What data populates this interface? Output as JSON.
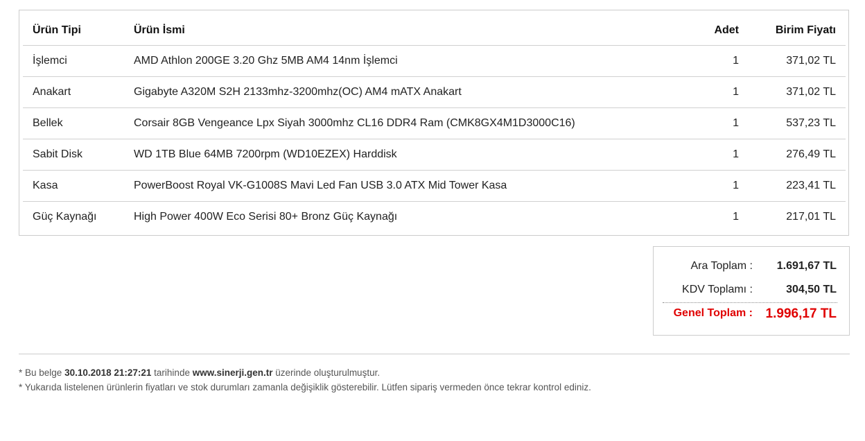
{
  "table": {
    "headers": {
      "type": "Ürün Tipi",
      "name": "Ürün İsmi",
      "qty": "Adet",
      "price": "Birim Fiyatı"
    },
    "rows": [
      {
        "type": "İşlemci",
        "name": "AMD Athlon 200GE 3.20 Ghz 5MB AM4 14nm İşlemci",
        "qty": "1",
        "price": "371,02 TL"
      },
      {
        "type": "Anakart",
        "name": "Gigabyte A320M S2H 2133mhz-3200mhz(OC) AM4 mATX Anakart",
        "qty": "1",
        "price": "371,02 TL"
      },
      {
        "type": "Bellek",
        "name": "Corsair 8GB Vengeance Lpx Siyah 3000mhz CL16 DDR4 Ram (CMK8GX4M1D3000C16)",
        "qty": "1",
        "price": "537,23 TL"
      },
      {
        "type": "Sabit Disk",
        "name": "WD 1TB Blue 64MB 7200rpm (WD10EZEX) Harddisk",
        "qty": "1",
        "price": "276,49 TL"
      },
      {
        "type": "Kasa",
        "name": "PowerBoost Royal VK-G1008S Mavi Led Fan USB 3.0 ATX Mid Tower Kasa",
        "qty": "1",
        "price": "223,41 TL"
      },
      {
        "type": "Güç Kaynağı",
        "name": "High Power 400W Eco Serisi 80+ Bronz Güç Kaynağı",
        "qty": "1",
        "price": "217,01 TL"
      }
    ]
  },
  "totals": {
    "subtotal_label": "Ara Toplam :",
    "subtotal_value": "1.691,67 TL",
    "vat_label": "KDV Toplamı :",
    "vat_value": "304,50 TL",
    "grand_label": "Genel Toplam :",
    "grand_value": "1.996,17 TL",
    "grand_color": "#e00000"
  },
  "footer": {
    "note1_prefix": "* Bu belge ",
    "note1_date": "30.10.2018 21:27:21",
    "note1_mid": " tarihinde ",
    "note1_site": "www.sinerji.gen.tr",
    "note1_suffix": " üzerinde oluşturulmuştur.",
    "note2": "* Yukarıda listelenen ürünlerin fiyatları ve stok durumları zamanla değişiklik gösterebilir. Lütfen sipariş vermeden önce tekrar kontrol ediniz."
  }
}
